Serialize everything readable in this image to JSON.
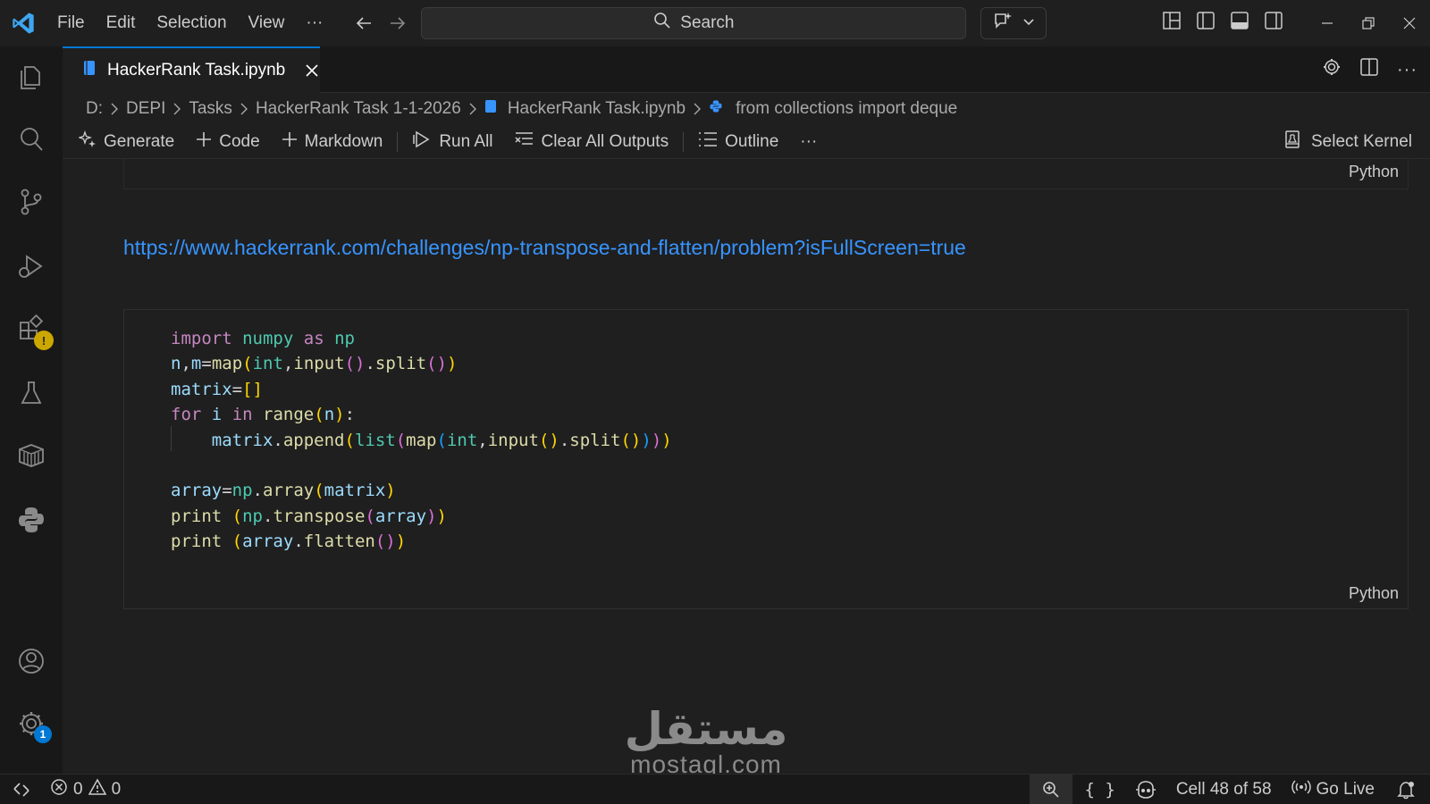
{
  "menu": [
    "File",
    "Edit",
    "Selection",
    "View",
    "···"
  ],
  "search": {
    "label": "Search"
  },
  "tab": {
    "title": "HackerRank Task.ipynb"
  },
  "breadcrumb": [
    "D:",
    "DEPI",
    "Tasks",
    "HackerRank Task 1-1-2026",
    "HackerRank Task.ipynb",
    "from collections import deque"
  ],
  "toolbar": {
    "generate": "Generate",
    "code": "Code",
    "markdown": "Markdown",
    "run_all": "Run All",
    "clear_outputs": "Clear All Outputs",
    "outline": "Outline",
    "more": "···",
    "kernel": "Select Kernel"
  },
  "cells": {
    "prev_lang": "Python",
    "markdown_link": "https://www.hackerrank.com/challenges/np-transpose-and-flatten/problem?isFullScreen=true",
    "code_lang": "Python",
    "code_lines": [
      "import numpy as np",
      "n,m=map(int,input().split())",
      "matrix=[]",
      "for i in range(n):",
      "    matrix.append(list(map(int,input().split())))",
      "",
      "array=np.array(matrix)",
      "print (np.transpose(array))",
      "print (array.flatten())"
    ]
  },
  "watermark": {
    "arabic": "مستقل",
    "latin": "mostaql.com"
  },
  "status": {
    "errors": "0",
    "warnings": "0",
    "cell": "Cell 48 of 58",
    "go_live": "Go Live"
  },
  "badges": {
    "settings": "1"
  },
  "colors": {
    "accent": "#0078d4",
    "link": "#3794ff",
    "warning": "#cca700"
  }
}
